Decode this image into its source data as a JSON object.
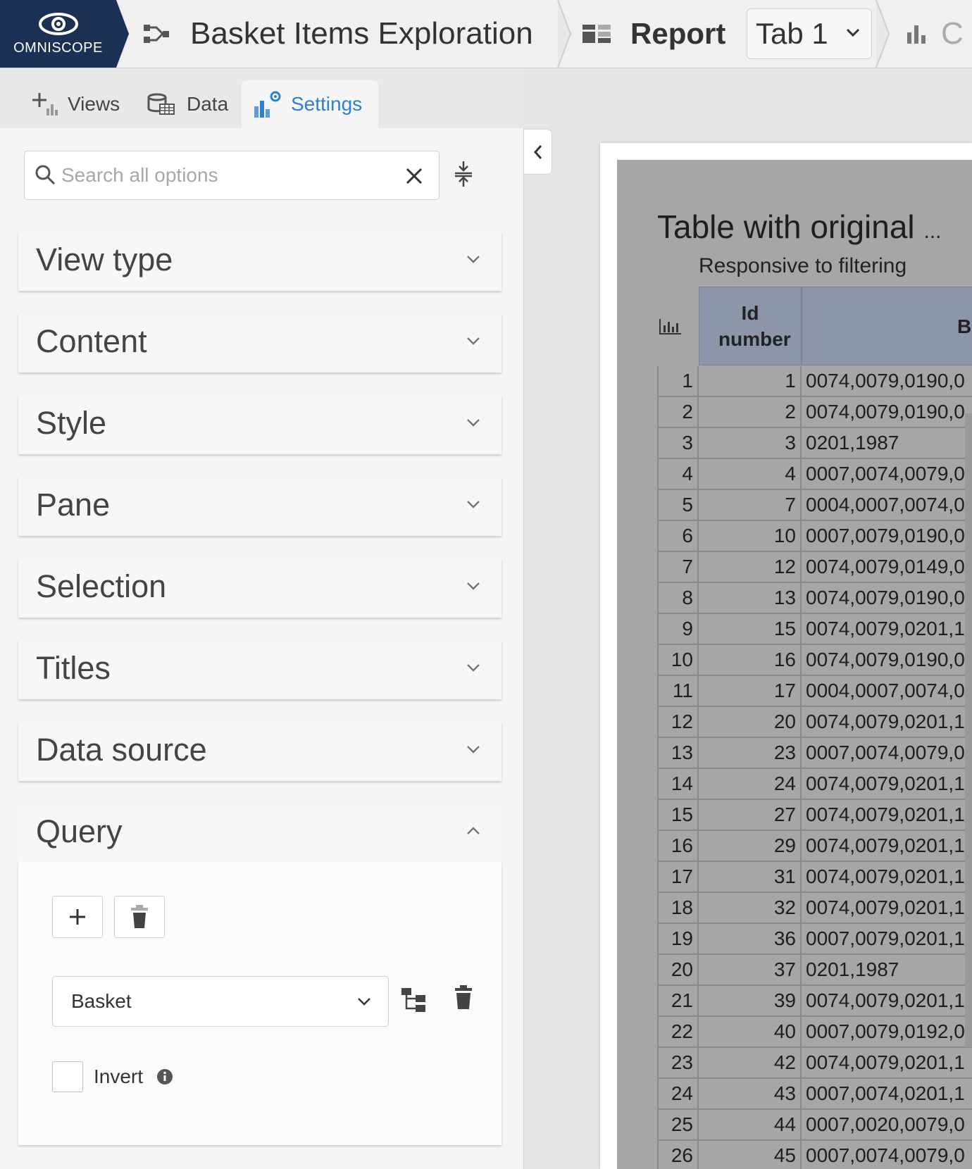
{
  "header": {
    "logo_text": "OMNISCOPE",
    "project_title": "Basket Items Exploration",
    "report_title": "Report",
    "tab_value": "Tab 1",
    "next_crumb": "C"
  },
  "panel": {
    "tabs": [
      {
        "label": "Views"
      },
      {
        "label": "Data"
      },
      {
        "label": "Settings"
      }
    ],
    "search": {
      "placeholder": "Search all options",
      "value": ""
    },
    "sections": [
      {
        "label": "View type"
      },
      {
        "label": "Content"
      },
      {
        "label": "Style"
      },
      {
        "label": "Pane"
      },
      {
        "label": "Selection"
      },
      {
        "label": "Titles"
      },
      {
        "label": "Data source"
      },
      {
        "label": "Query"
      }
    ],
    "query": {
      "field_value": "Basket",
      "invert_label": "Invert",
      "invert_checked": false
    }
  },
  "view": {
    "title": "Table with original",
    "title_ellipsis": "...",
    "subtitle": "Responsive to filtering",
    "columns": [
      "Id number",
      "B"
    ],
    "rows": [
      {
        "idx": "1",
        "id": "1",
        "basket": "0074,0079,0190,0"
      },
      {
        "idx": "2",
        "id": "2",
        "basket": "0074,0079,0190,0"
      },
      {
        "idx": "3",
        "id": "3",
        "basket": "0201,1987"
      },
      {
        "idx": "4",
        "id": "4",
        "basket": "0007,0074,0079,0"
      },
      {
        "idx": "5",
        "id": "7",
        "basket": "0004,0007,0074,0"
      },
      {
        "idx": "6",
        "id": "10",
        "basket": "0007,0079,0190,0"
      },
      {
        "idx": "7",
        "id": "12",
        "basket": "0074,0079,0149,0"
      },
      {
        "idx": "8",
        "id": "13",
        "basket": "0074,0079,0190,0"
      },
      {
        "idx": "9",
        "id": "15",
        "basket": "0074,0079,0201,1"
      },
      {
        "idx": "10",
        "id": "16",
        "basket": "0074,0079,0190,0"
      },
      {
        "idx": "11",
        "id": "17",
        "basket": "0004,0007,0074,0"
      },
      {
        "idx": "12",
        "id": "20",
        "basket": "0074,0079,0201,1"
      },
      {
        "idx": "13",
        "id": "23",
        "basket": "0007,0074,0079,0"
      },
      {
        "idx": "14",
        "id": "24",
        "basket": "0074,0079,0201,1"
      },
      {
        "idx": "15",
        "id": "27",
        "basket": "0074,0079,0201,1"
      },
      {
        "idx": "16",
        "id": "29",
        "basket": "0074,0079,0201,1"
      },
      {
        "idx": "17",
        "id": "31",
        "basket": "0074,0079,0201,1"
      },
      {
        "idx": "18",
        "id": "32",
        "basket": "0074,0079,0201,1"
      },
      {
        "idx": "19",
        "id": "36",
        "basket": "0007,0079,0201,1"
      },
      {
        "idx": "20",
        "id": "37",
        "basket": "0201,1987"
      },
      {
        "idx": "21",
        "id": "39",
        "basket": "0074,0079,0201,1"
      },
      {
        "idx": "22",
        "id": "40",
        "basket": "0007,0079,0192,0"
      },
      {
        "idx": "23",
        "id": "42",
        "basket": "0074,0079,0201,1"
      },
      {
        "idx": "24",
        "id": "43",
        "basket": "0007,0074,0201,1"
      },
      {
        "idx": "25",
        "id": "44",
        "basket": "0007,0020,0079,0"
      },
      {
        "idx": "26",
        "id": "45",
        "basket": "0007,0074,0079,0"
      }
    ]
  },
  "colors": {
    "brand_navy": "#1a3055",
    "accent_blue": "#2f7fd0",
    "table_header": "#8d96a8",
    "view_background": "#a6a6a6"
  }
}
